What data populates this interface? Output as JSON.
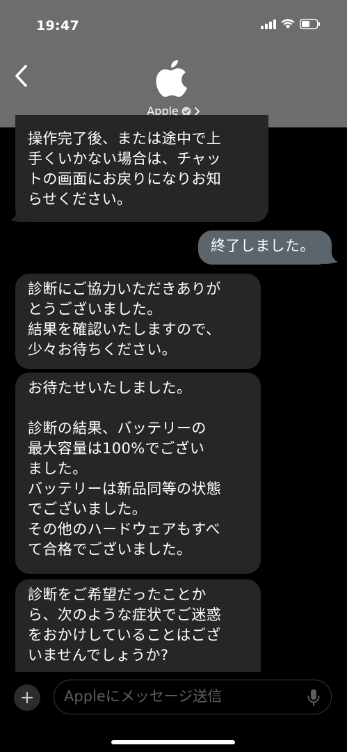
{
  "status_bar": {
    "time": "19:47"
  },
  "header": {
    "contact_name": "Apple"
  },
  "messages": [
    {
      "direction": "incoming",
      "text": "操作完了後、または途中で上\n手くいかない場合は、チャッ\nトの画面にお戻りになりお知\nらせください。"
    },
    {
      "direction": "outgoing",
      "text": "終了しました。"
    },
    {
      "direction": "incoming",
      "text": "診断にご協力いただきありが\nとうございました。\n結果を確認いたしますので、\n少々お待ちください。"
    },
    {
      "direction": "incoming",
      "text": "お待たせいたしました。\n\n診断の結果、バッテリーの\n最大容量は100%でござい\nました。\nバッテリーは新品同等の状態\nでございました。\nその他のハードウェアもすべ\nて合格でございました。"
    },
    {
      "direction": "incoming",
      "text": "診断をご希望だったことか\nら、次のような症状でご迷惑\nをおかけしていることはござ\nいませんでしょうか?"
    }
  ],
  "composer": {
    "placeholder": "Appleにメッセージ送信"
  },
  "colors": {
    "header_bg": "#6d6d6d",
    "incoming_bubble": "#262628",
    "outgoing_bubble": "#5c646c"
  },
  "icons": [
    "signal-icon",
    "wifi-icon",
    "battery-icon",
    "back-chevron-icon",
    "apple-logo-icon",
    "verified-badge-icon",
    "chevron-right-icon",
    "plus-icon",
    "microphone-icon"
  ]
}
